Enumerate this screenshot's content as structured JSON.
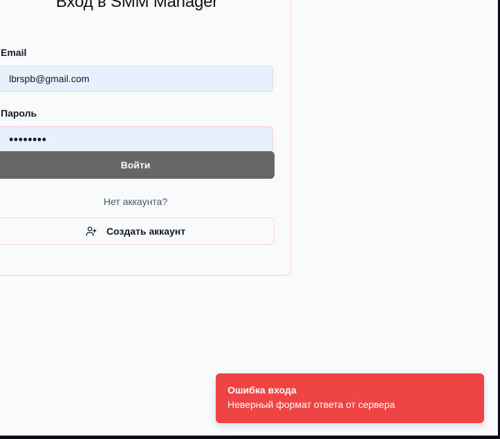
{
  "login_form": {
    "title": "Вход в SMM Manager",
    "email_label": "Email",
    "email_value": "lbrspb@gmail.com",
    "password_label": "Пароль",
    "password_value": "••••••••",
    "login_button": "Войти",
    "no_account_text": "Нет аккаунта?",
    "create_account_button": "Создать аккаунт",
    "create_account_icon": "user-plus-icon"
  },
  "toast": {
    "title": "Ошибка входа",
    "message": "Неверный формат ответа от сервера",
    "color": "#ef4444"
  },
  "colors": {
    "background": "#f8fafc",
    "input_background": "#e8f0fe",
    "border": "#f5d2dc",
    "login_button": "#666666"
  }
}
